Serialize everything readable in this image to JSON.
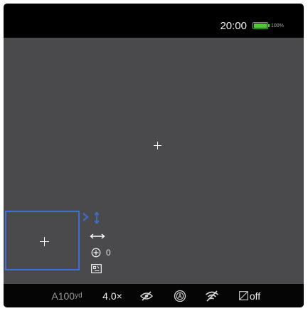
{
  "status_bar": {
    "time": "20:00",
    "battery_percent_label": "100%",
    "battery_level": 1.0,
    "battery_color": "#4ecb34"
  },
  "viewfinder": {
    "background_color": "#4a4a4c"
  },
  "pip": {
    "frame_color": "#3f6fd6",
    "offset_value": "0"
  },
  "bottom_bar": {
    "distance_value": "A100",
    "distance_unit": "yd",
    "zoom": "4.0×",
    "recording_status": "off",
    "icons": [
      "eye-crossed-icon",
      "auto-mode-icon",
      "wifi-off-icon",
      "pip-off-icon"
    ]
  }
}
